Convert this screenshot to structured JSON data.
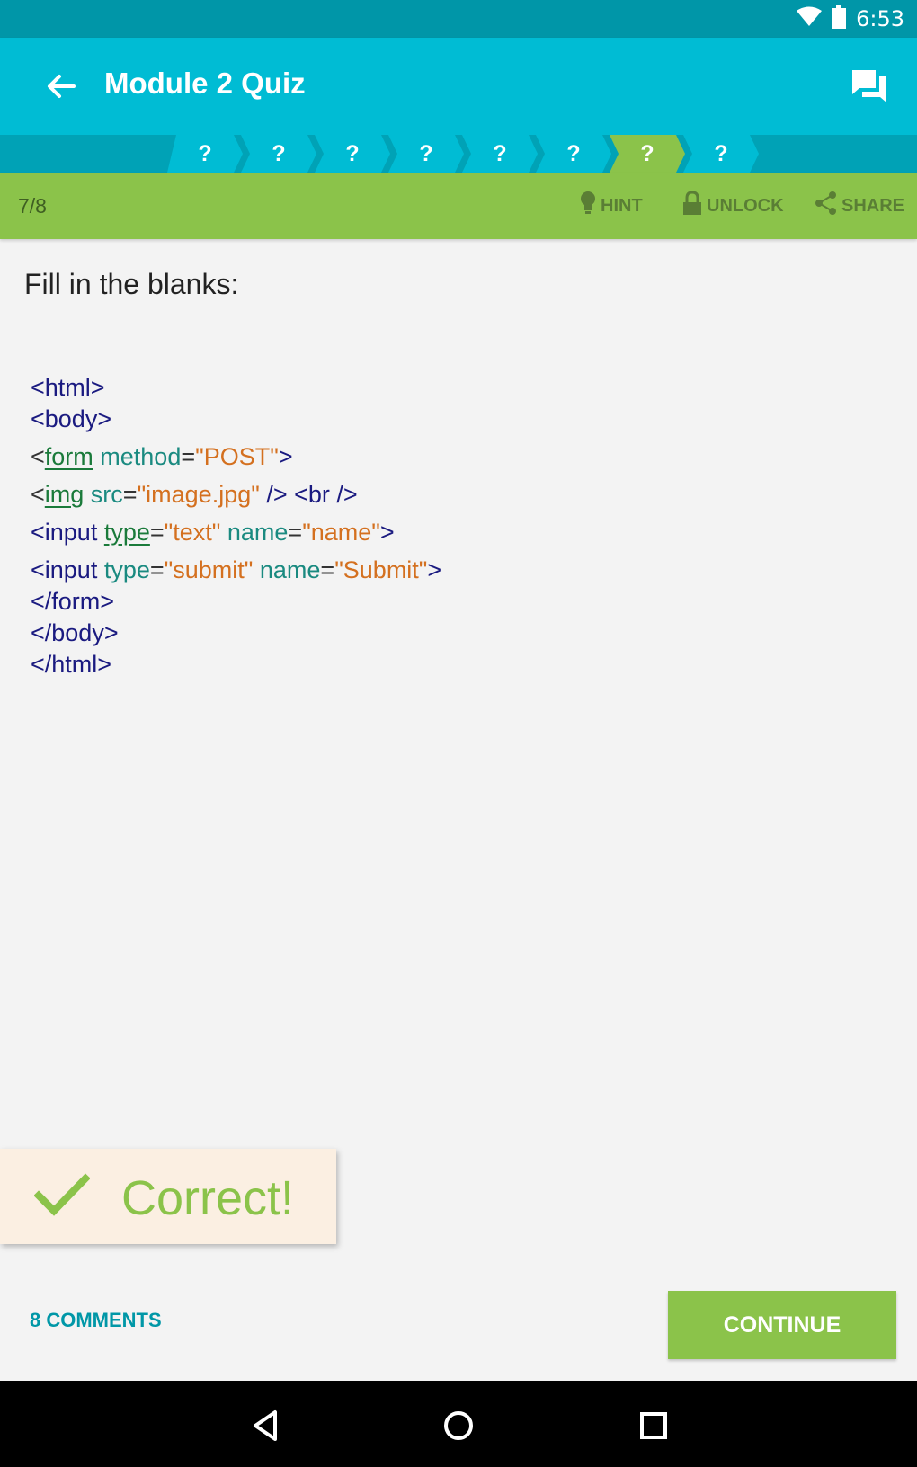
{
  "status": {
    "time": "6:53"
  },
  "appbar": {
    "title": "Module 2 Quiz"
  },
  "progress": {
    "items": [
      "?",
      "?",
      "?",
      "?",
      "?",
      "?",
      "?",
      "?"
    ],
    "current_index": 6
  },
  "toolbar": {
    "counter": "7/8",
    "hint_label": "HINT",
    "unlock_label": "UNLOCK",
    "share_label": "SHARE"
  },
  "question": {
    "prompt": "Fill in the blanks:"
  },
  "code": {
    "line1": "<html>",
    "line2": "<body>",
    "line3": {
      "open": "<",
      "tag": "form",
      "attr": " method",
      "eq": "=",
      "val": "\"POST\"",
      "close": ">"
    },
    "line4": {
      "open": "<",
      "tag": "img",
      "attr": " src",
      "eq": "=",
      "val": "\"image.jpg\"",
      "rest": " /> <br />"
    },
    "line5": {
      "open": "<input ",
      "kw": "type",
      "eq1": "=",
      "val1": "\"text\"",
      "attr2": " name",
      "eq2": "=",
      "val2": "\"name\"",
      "close": ">"
    },
    "line6": {
      "open": "<input ",
      "attr1": "type",
      "eq1": "=",
      "val1": "\"submit\"",
      "attr2": " name",
      "eq2": "=",
      "val2": "\"Submit\"",
      "close": ">"
    },
    "line7": "</form>",
    "line8": "</body>",
    "line9": "</html>"
  },
  "feedback": {
    "label": "Correct!"
  },
  "footer": {
    "comments_label": "8 COMMENTS",
    "continue_label": "CONTINUE"
  },
  "colors": {
    "accent": "#00bcd4",
    "success": "#8bc34a",
    "link": "#0097a7"
  }
}
